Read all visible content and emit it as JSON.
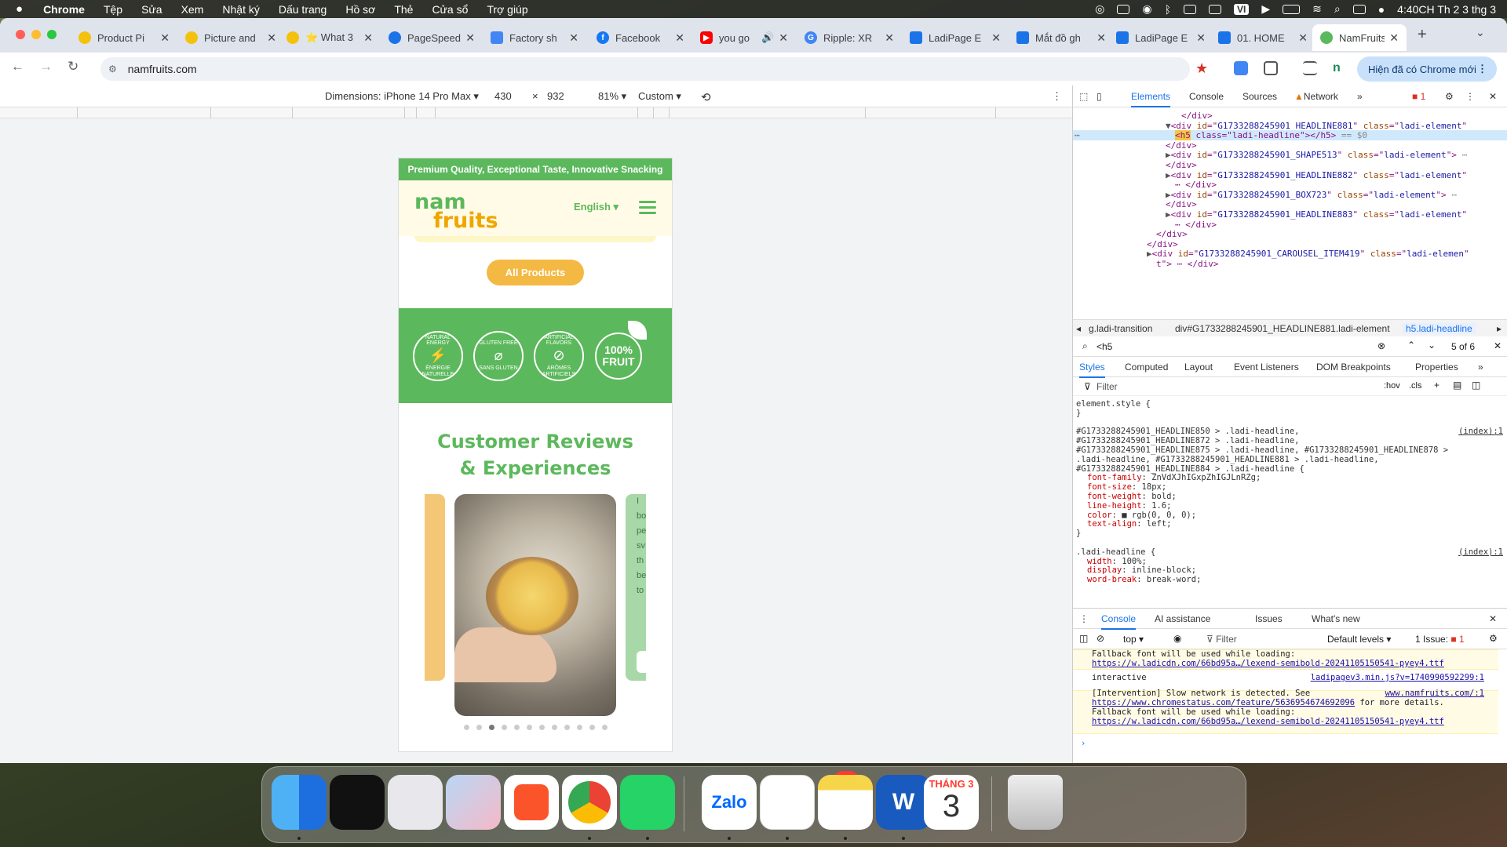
{
  "menubar": {
    "apple": "",
    "app_name": "Chrome",
    "items": [
      "Tệp",
      "Sửa",
      "Xem",
      "Nhật ký",
      "Dấu trang",
      "Hồ sơ",
      "Thẻ",
      "Cửa sổ",
      "Trợ giúp"
    ],
    "clock": "4:40CH Th 2 3 thg 3",
    "input_method": "VI"
  },
  "tabs": [
    {
      "title": "Product Pi",
      "color": "#f4c20d"
    },
    {
      "title": "Picture and",
      "color": "#f4c20d"
    },
    {
      "title": "⭐ What 3",
      "color": "#f4c20d"
    },
    {
      "title": "PageSpeed",
      "color": "#1a73e8"
    },
    {
      "title": "Factory sh",
      "color": "#4285f4"
    },
    {
      "title": "Facebook",
      "color": "#1877f2"
    },
    {
      "title": "you go",
      "color": "#ff0000"
    },
    {
      "title": "Ripple: XR",
      "color": "#4285f4"
    },
    {
      "title": "LadiPage E",
      "color": "#1a73e8"
    },
    {
      "title": "Mắt đồ gh",
      "color": "#1a73e8"
    },
    {
      "title": "LadiPage E",
      "color": "#1a73e8"
    },
    {
      "title": "01. HOME",
      "color": "#1a73e8"
    },
    {
      "title": "NamFruits",
      "color": "#5cb85c"
    }
  ],
  "toolbar": {
    "url": "namfruits.com",
    "update_label": "Hiện đã có Chrome mới"
  },
  "device_toolbar": {
    "dimensions_label": "Dimensions: iPhone 14 Pro Max",
    "width": "430",
    "times": "×",
    "height": "932",
    "zoom": "81%",
    "throttle": "Custom"
  },
  "site": {
    "promo": "Premium Quality, Exceptional Taste, Innovative Snacking",
    "logo_top": "nam",
    "logo_bottom": "fruits",
    "language": "English ▾",
    "all_products": "All Products",
    "badges": [
      {
        "top": "NATURAL ENERGY",
        "bottom": "ÉNERGIE NATURELLE"
      },
      {
        "top": "GLUTEN FREE",
        "bottom": "SANS GLUTEN"
      },
      {
        "top": "ARTIFICIAL FLAVORS",
        "bottom": "ARÔMES ARTIFICIELS"
      },
      {
        "line1": "100%",
        "line2": "FRUIT"
      }
    ],
    "reviews_line1": "Customer Reviews",
    "reviews_line2": "& Experiences",
    "right_card_text": [
      "I",
      "bo",
      "pe",
      "sv",
      "th",
      "be",
      "to"
    ],
    "carousel_count": 12,
    "carousel_active": 3
  },
  "devtools": {
    "tabs": [
      "Elements",
      "Console",
      "Sources",
      "Network"
    ],
    "error_count": "1",
    "dom_lines": [
      {
        "indent": 138,
        "html": "</div>"
      },
      {
        "indent": 118,
        "arrow": "▼",
        "tag": "div",
        "id": "G1733288245901_HEADLINE881",
        "cls": "ladi-element"
      },
      {
        "indent": 130,
        "sel": true,
        "hl": "<h5",
        "rest": " class=\"ladi-headline\"></h5>",
        "eq": " == $0"
      },
      {
        "indent": 118,
        "html": "</div>"
      },
      {
        "indent": 118,
        "arrow": "▶",
        "tag": "div",
        "id": "G1733288245901_SHAPE513",
        "cls": "ladi-element",
        "more": true
      },
      {
        "indent": 118,
        "html": "</div>"
      },
      {
        "indent": 118,
        "arrow": "▶",
        "tag": "div",
        "id": "G1733288245901_HEADLINE882",
        "cls": "ladi-element"
      },
      {
        "indent": 130,
        "html": "⋯ </div>"
      },
      {
        "indent": 118,
        "arrow": "▶",
        "tag": "div",
        "id": "G1733288245901_BOX723",
        "cls": "ladi-element",
        "more": true
      },
      {
        "indent": 118,
        "html": "</div>"
      },
      {
        "indent": 118,
        "arrow": "▶",
        "tag": "div",
        "id": "G1733288245901_HEADLINE883",
        "cls": "ladi-element"
      },
      {
        "indent": 130,
        "html": "⋯ </div>"
      },
      {
        "indent": 106,
        "html": "</div>"
      },
      {
        "indent": 94,
        "html": "</div>"
      },
      {
        "indent": 94,
        "arrow": "▶",
        "tag": "div",
        "id": "G1733288245901_CAROUSEL_ITEM419",
        "cls": "ladi-elemen"
      },
      {
        "indent": 106,
        "html": "t\"> ⋯ </div>"
      }
    ],
    "breadcrumbs": [
      "g.ladi-transition",
      "div#G1733288245901_HEADLINE881.ladi-element",
      "h5.ladi-headline"
    ],
    "search_value": "<h5",
    "search_count": "5 of 6",
    "styles_tabs": [
      "Styles",
      "Computed",
      "Layout",
      "Event Listeners",
      "DOM Breakpoints",
      "Properties"
    ],
    "filter_placeholder": "Filter",
    "hov": ":hov",
    "cls": ".cls",
    "style_lines": [
      {
        "t": "element.style {"
      },
      {
        "t": "}"
      },
      {
        "t": ""
      },
      {
        "t": "#G1733288245901_HEADLINE850 > .ladi-headline,",
        "src": "(index):1"
      },
      {
        "t": "#G1733288245901_HEADLINE872 > .ladi-headline,"
      },
      {
        "t": "#G1733288245901_HEADLINE875 > .ladi-headline, #G1733288245901_HEADLINE878 >"
      },
      {
        "t": ".ladi-headline, #G1733288245901_HEADLINE881 > .ladi-headline,"
      },
      {
        "t": "#G1733288245901_HEADLINE884 > .ladi-headline {"
      },
      {
        "p": "font-family",
        "v": "ZnVdXJhIGxpZhIGJLnRZg;"
      },
      {
        "p": "font-size",
        "v": "18px;"
      },
      {
        "p": "font-weight",
        "v": "bold;"
      },
      {
        "p": "line-height",
        "v": "1.6;"
      },
      {
        "p": "color",
        "v": "■ rgb(0, 0, 0);"
      },
      {
        "p": "text-align",
        "v": "left;"
      },
      {
        "t": "}"
      },
      {
        "t": ""
      },
      {
        "t": ".ladi-headline {",
        "src": "(index):1"
      },
      {
        "p": "width",
        "v": "100%;"
      },
      {
        "p": "display",
        "v": "inline-block;"
      },
      {
        "p": "word-break",
        "v": "break-word;"
      }
    ],
    "drawer_tabs": [
      "Console",
      "AI assistance",
      "Issues",
      "What's new"
    ],
    "context": "top ▾",
    "levels": "Default levels ▾",
    "issues": "1 Issue:",
    "console": [
      {
        "text": "Fallback font will be used while loading:"
      },
      {
        "link": "https://w.ladicdn.com/66bd95a…/lexend-semibold-20241105150541-pyey4.ttf"
      },
      {
        "text": "interactive",
        "src": "ladipagev3.min.js?v=1740990592299:1"
      },
      {
        "text": "[Intervention] Slow network is detected. See",
        "src": "www.namfruits.com/:1"
      },
      {
        "link": "https://www.chromestatus.com/feature/5636954674692096",
        "after": " for more details."
      },
      {
        "text": "Fallback font will be used while loading:"
      },
      {
        "link": "https://w.ladicdn.com/66bd95a…/lexend-semibold-20241105150541-pyey4.ttf"
      }
    ],
    "prompt": "›"
  },
  "dock": {
    "zalo_badge": "5+",
    "zalo_label": "Zalo",
    "calendar_month": "THÁNG 3",
    "calendar_day": "3"
  }
}
